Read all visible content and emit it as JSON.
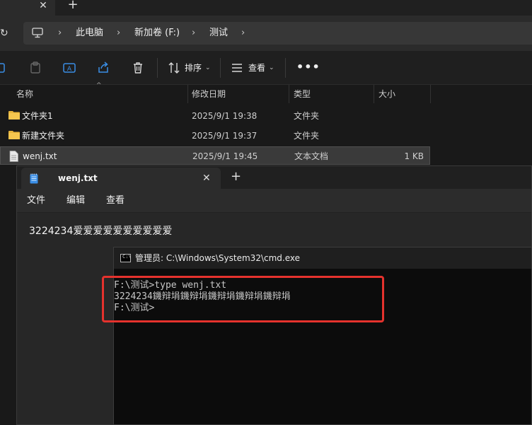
{
  "explorer": {
    "tab": {
      "close_glyph": "✕",
      "new_tab_glyph": "+"
    },
    "breadcrumb": [
      {
        "label": "此电脑"
      },
      {
        "label": "新加卷 (F:)"
      },
      {
        "label": "测试"
      }
    ],
    "toolbar": {
      "sort_label": "排序",
      "view_label": "查看",
      "more_glyph": "•••"
    },
    "columns": {
      "name": "名称",
      "modified": "修改日期",
      "type": "类型",
      "size": "大小"
    },
    "files": [
      {
        "name": "文件夹1",
        "modified": "2025/9/1 19:38",
        "type": "文件夹",
        "size": "",
        "icon": "folder-icon"
      },
      {
        "name": "新建文件夹",
        "modified": "2025/9/1 19:37",
        "type": "文件夹",
        "size": "",
        "icon": "folder-icon"
      },
      {
        "name": "wenj.txt",
        "modified": "2025/9/1 19:45",
        "type": "文本文档",
        "size": "1 KB",
        "icon": "text-file-icon",
        "selected": true
      }
    ]
  },
  "notepad": {
    "tab_title": "wenj.txt",
    "close_glyph": "✕",
    "new_tab_glyph": "+",
    "menu": [
      "文件",
      "编辑",
      "查看"
    ],
    "content": "3224234爱爱爱爱爱爱爱爱爱爱"
  },
  "cmd": {
    "title": "管理员: C:\\Windows\\System32\\cmd.exe",
    "icon_text": "C:\\",
    "lines": [
      "F:\\测试>type wenj.txt",
      "3224234鐖辩埍鐖辩埍鐖辩埍鐖辩埍鐖辩埍",
      "F:\\测试>"
    ]
  },
  "colors": {
    "highlight": "#e5322d",
    "folder": "#e8b53c",
    "notepad_icon": "#3a8ee6"
  }
}
